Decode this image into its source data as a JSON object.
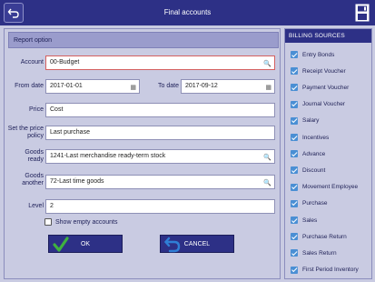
{
  "header": {
    "title": "Final accounts",
    "back_icon": "back-arrow-icon",
    "save_icon": "save-icon"
  },
  "report": {
    "section_title": "Report option",
    "account": {
      "label": "Account",
      "value": "00-Budget"
    },
    "from_date": {
      "label": "From date",
      "value": "2017-01-01"
    },
    "to_date": {
      "label": "To date",
      "value": "2017-09-12"
    },
    "price": {
      "label": "Price",
      "value": "Cost"
    },
    "price_policy": {
      "label": "Set the price policy",
      "value": "Last purchase"
    },
    "goods_ready": {
      "label": "Goods ready",
      "value": "1241-Last merchandise ready-term stock"
    },
    "goods_another": {
      "label": "Goods another",
      "value": "72-Last time goods"
    },
    "level": {
      "label": "Level",
      "value": "2"
    },
    "show_empty": {
      "label": "Show empty accounts",
      "checked": false
    },
    "ok_label": "OK",
    "cancel_label": "CANCEL"
  },
  "billing": {
    "title": "BILLING SOURCES",
    "items": [
      "Entry Bonds",
      "Receipt Voucher",
      "Payment Voucher",
      "Journal Voucher",
      "Salary",
      "Incentives",
      "Advance",
      "Discount",
      "Movement Employee",
      "Purchase",
      "Sales",
      "Purchase Return",
      "Sales Return",
      "First Period Inventory"
    ]
  },
  "colors": {
    "header_bg": "#2d3086",
    "panel_bg": "#c9cbe2",
    "check": "#4a8fd4",
    "ok_icon": "#3fb23f",
    "cancel_icon": "#2f7fd6"
  }
}
